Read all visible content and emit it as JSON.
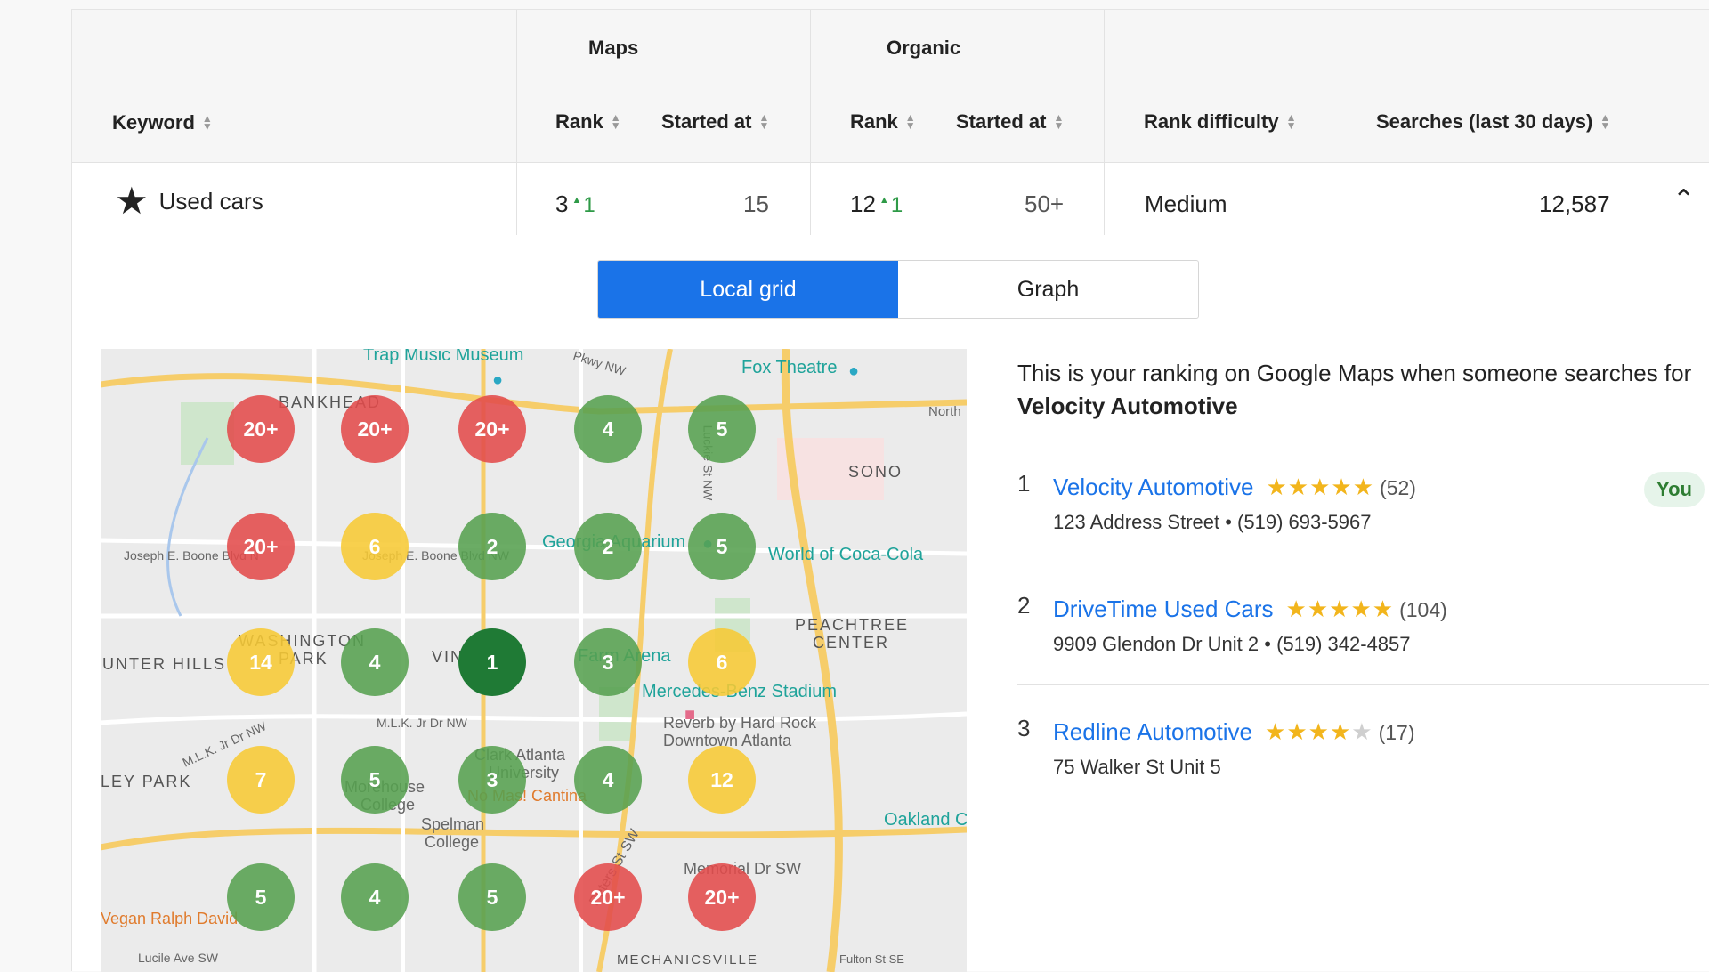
{
  "table": {
    "groups": {
      "maps": "Maps",
      "organic": "Organic"
    },
    "columns": {
      "keyword": "Keyword",
      "maps_rank": "Rank",
      "maps_started": "Started at",
      "organic_rank": "Rank",
      "organic_started": "Started at",
      "difficulty": "Rank difficulty",
      "searches": "Searches (last 30 days)"
    },
    "row": {
      "keyword": "Used cars",
      "maps_rank": "3",
      "maps_delta": "1",
      "maps_started": "15",
      "organic_rank": "12",
      "organic_delta": "1",
      "organic_started": "50+",
      "difficulty": "Medium",
      "searches": "12,587"
    }
  },
  "toggle": {
    "local_grid": "Local grid",
    "graph": "Graph"
  },
  "map": {
    "labels": {
      "trap": "Trap Music Museum",
      "fox": "Fox Theatre",
      "bankhead": "BANKHEAD",
      "north": "North",
      "sono": "SONO",
      "boone1": "Joseph E. Boone Blvd N",
      "boone2": "Joseph E. Boone Blvd NW",
      "aquarium": "Georgia Aquarium",
      "coke": "World of Coca-Cola",
      "washington": "WASHINGTON",
      "park": "PARK",
      "hunter": "UNTER HILLS",
      "peachtree": "PEACHTREE",
      "center": "CENTER",
      "vine": "VINE CI",
      "farm": "Farm Arena",
      "mercedes": "Mercedes-Benz Stadium",
      "mlk": "M.L.K. Jr Dr NW",
      "mlk2": "M.L.K. Jr Dr NW",
      "reverb": "Reverb by Hard Rock",
      "downtown": "Downtown Atlanta",
      "clark": "Clark Atlanta",
      "univ": "University",
      "ley": "LEY PARK",
      "more": "Morehouse",
      "college": "College",
      "nomas": "No Mas! Cantina",
      "oakland": "Oakland C",
      "spelman": "Spelman",
      "spelman2": "College",
      "memorial": "Memorial Dr SW",
      "vegan": "Vegan Ralph David",
      "lucile": "Lucile Ave SW",
      "mech": "MECHANICSVILLE",
      "fulton": "Fulton St SE",
      "peters": "Peters St SW",
      "lucke": "Luckie St NW",
      "pkwy": "Pkwy NW"
    },
    "grid": [
      [
        "20+",
        "20+",
        "20+",
        "4",
        "5"
      ],
      [
        "20+",
        "6",
        "2",
        "2",
        "5"
      ],
      [
        "14",
        "4",
        "1",
        "3",
        "6"
      ],
      [
        "7",
        "5",
        "3",
        "4",
        "12"
      ],
      [
        "5",
        "4",
        "5",
        "20+",
        "20+"
      ]
    ]
  },
  "intro": {
    "text": "This is your ranking on Google Maps when someone searches for ",
    "bold": "Velocity Automotive"
  },
  "results": [
    {
      "rank": "1",
      "name": "Velocity Automotive",
      "stars": 5,
      "reviews": "(52)",
      "address": "123 Address Street • (519) 693-5967",
      "badge": "You"
    },
    {
      "rank": "2",
      "name": "DriveTime Used Cars",
      "stars": 5,
      "reviews": "(104)",
      "address": "9909 Glendon Dr Unit 2 • (519) 342-4857"
    },
    {
      "rank": "3",
      "name": "Redline Automotive",
      "stars": 4,
      "reviews": "(17)",
      "address": "75 Walker St Unit 5"
    }
  ],
  "colors": {
    "accent": "#1a73e8",
    "red": "#e24b4b",
    "yellow": "#f7c934",
    "green": "#56a050",
    "dark_green": "#1f7a35",
    "star": "#f2b51c"
  }
}
